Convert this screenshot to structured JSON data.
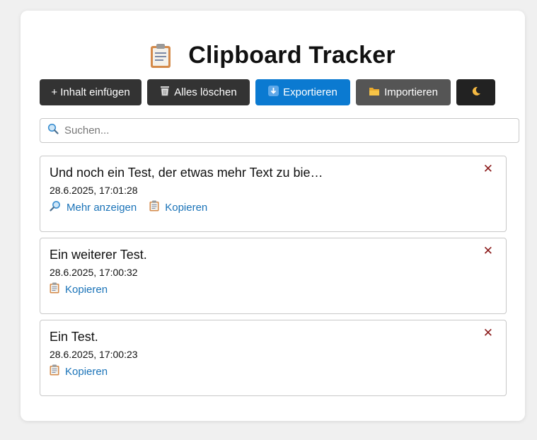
{
  "app": {
    "title": "Clipboard Tracker",
    "title_icon": "clipboard-icon"
  },
  "toolbar": {
    "add_label": "+ Inhalt einfügen",
    "clear_label": "Alles löschen",
    "clear_icon": "trash-icon",
    "export_label": "Exportieren",
    "export_icon": "download-arrow-icon",
    "import_label": "Importieren",
    "import_icon": "folder-icon",
    "theme_icon": "moon-icon"
  },
  "search": {
    "placeholder": "Suchen...",
    "value": "",
    "icon": "search-icon"
  },
  "entries": [
    {
      "text": "Und noch ein Test, der etwas mehr Text zu bie…",
      "time": "28.6.2025, 17:01:28",
      "more_label": "Mehr anzeigen",
      "copy_label": "Kopieren",
      "delete_label": "✕"
    },
    {
      "text": "Ein weiterer Test.",
      "time": "28.6.2025, 17:00:32",
      "copy_label": "Kopieren",
      "delete_label": "✕"
    },
    {
      "text": "Ein Test.",
      "time": "28.6.2025, 17:00:23",
      "copy_label": "Kopieren",
      "delete_label": "✕"
    }
  ],
  "colors": {
    "dark_button": "#333333",
    "export_button": "#0b7ad1",
    "import_button": "#555555",
    "link": "#1a73b8",
    "delete": "#8b1a1a"
  }
}
